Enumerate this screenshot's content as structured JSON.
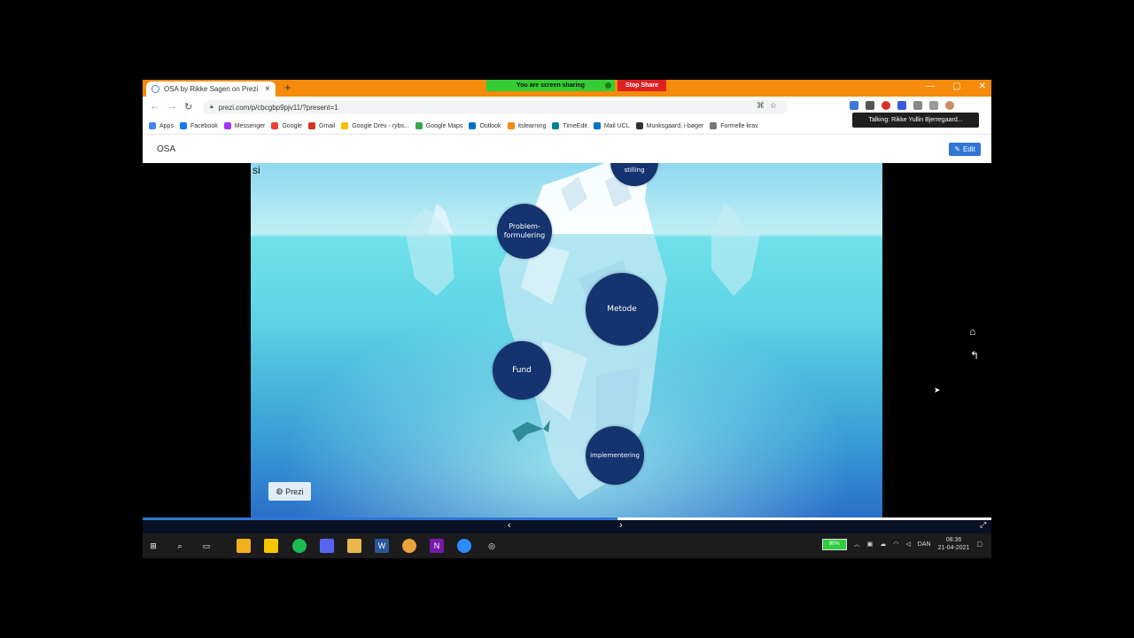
{
  "browser": {
    "tab_title": "OSA by Rikke Sagen on Prezi Ne",
    "tab_close": "×",
    "new_tab": "+",
    "sharing_text": "You are screen sharing",
    "stop_share": "Stop Share",
    "url": "prezi.com/p/cbcgbp9pjv11/?present=1",
    "talking_tooltip": "Talking: Rikke Yullin Bjerregaard...",
    "window_controls": [
      "—",
      "▢",
      "✕"
    ]
  },
  "bookmarks": [
    {
      "label": "Apps",
      "color": "#4285f4"
    },
    {
      "label": "Facebook",
      "color": "#1877f2"
    },
    {
      "label": "Messenger",
      "color": "#a334fa"
    },
    {
      "label": "Google",
      "color": "#ea4335"
    },
    {
      "label": "Gmail",
      "color": "#d93025"
    },
    {
      "label": "Google Drev - rybs...",
      "color": "#fbbc04"
    },
    {
      "label": "Google Maps",
      "color": "#34a853"
    },
    {
      "label": "Outlook",
      "color": "#0072c6"
    },
    {
      "label": "itslearning",
      "color": "#f58a0b"
    },
    {
      "label": "TimeEdit",
      "color": "#00838f"
    },
    {
      "label": "Mail UCL",
      "color": "#0072c6"
    },
    {
      "label": "Munksgaard, i-bøger",
      "color": "#333333"
    },
    {
      "label": "Formelle krav",
      "color": "#777777"
    }
  ],
  "prezi": {
    "title": "OSA",
    "edit_label": "Edit",
    "page_char": "si",
    "watermark": "Prezi",
    "topics": [
      {
        "label": "stilling"
      },
      {
        "label": "Problem-\nformulering"
      },
      {
        "label": "Metode"
      },
      {
        "label": "Fund"
      },
      {
        "label": "implementering"
      }
    ],
    "progress_percent": 56,
    "prev": "‹",
    "next": "›",
    "fullscreen": "⤢",
    "home_icon": "⌂",
    "back_icon": "↰"
  },
  "taskbar": {
    "battery": "90%",
    "language": "DAN",
    "time": "08:36",
    "date": "21-04-2021"
  },
  "colors": {
    "tab_strip": "#f58a0b",
    "share_green": "#33cc33",
    "stop_red": "#e02020",
    "bubble": "#14336f",
    "edit_blue": "#2f76d6"
  }
}
